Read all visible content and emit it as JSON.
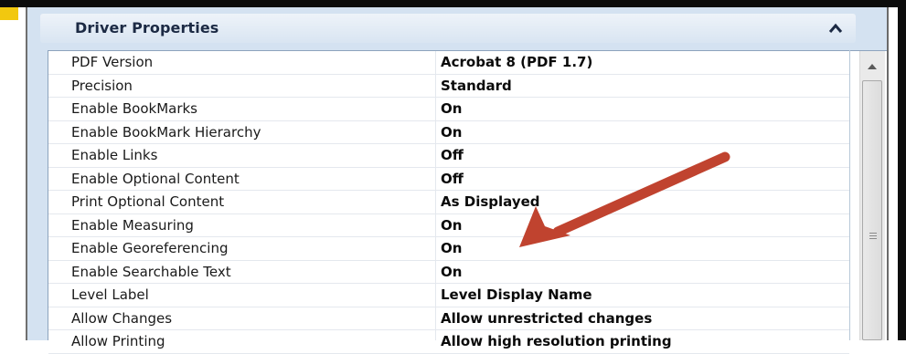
{
  "panel": {
    "title": "Driver Properties",
    "collapse_icon": "chevron-up-icon"
  },
  "properties": [
    {
      "name": "PDF Version",
      "value": "Acrobat 8 (PDF 1.7)"
    },
    {
      "name": "Precision",
      "value": "Standard"
    },
    {
      "name": "Enable BookMarks",
      "value": "On"
    },
    {
      "name": "Enable BookMark Hierarchy",
      "value": "On"
    },
    {
      "name": "Enable Links",
      "value": "Off"
    },
    {
      "name": "Enable Optional Content",
      "value": "Off"
    },
    {
      "name": "Print Optional Content",
      "value": "As Displayed"
    },
    {
      "name": "Enable Measuring",
      "value": "On"
    },
    {
      "name": "Enable Georeferencing",
      "value": "On"
    },
    {
      "name": "Enable Searchable Text",
      "value": "On"
    },
    {
      "name": "Level Label",
      "value": "Level Display Name"
    },
    {
      "name": "Allow Changes",
      "value": "Allow unrestricted changes"
    },
    {
      "name": "Allow Printing",
      "value": "Allow high resolution printing"
    }
  ],
  "annotation": {
    "arrow_color": "#c0432f",
    "points_to": "Enable Georeferencing"
  },
  "colors": {
    "panel_background": "#d4e2f1",
    "title_text": "#1c2a44"
  }
}
